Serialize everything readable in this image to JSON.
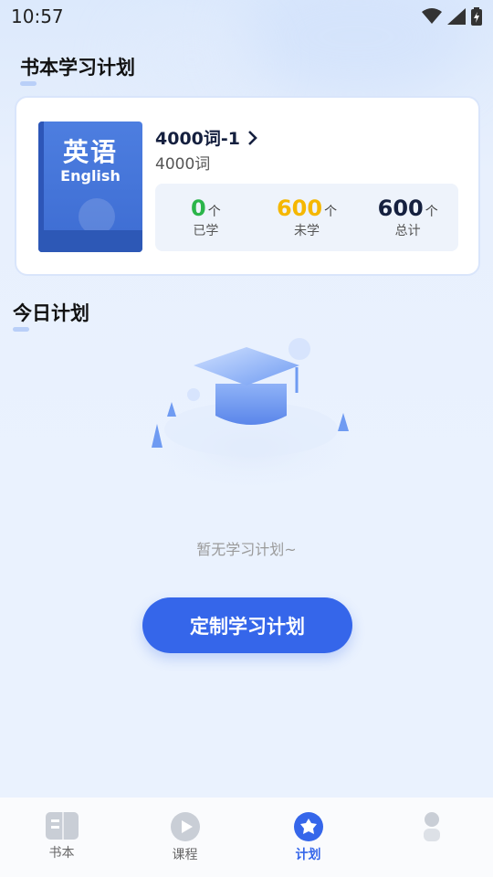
{
  "status_bar": {
    "time": "10:57"
  },
  "book_section": {
    "title": "书本学习计划"
  },
  "book": {
    "cover_zh": "英语",
    "cover_en": "English",
    "title": "4000词-1",
    "subtitle": "4000词",
    "stats": [
      {
        "value": "0",
        "unit": "个",
        "label": "已学",
        "color": "#2bb54a"
      },
      {
        "value": "600",
        "unit": "个",
        "label": "未学",
        "color": "#f5b700"
      },
      {
        "value": "600",
        "unit": "个",
        "label": "总计",
        "color": "#15203f"
      }
    ]
  },
  "today_section": {
    "title": "今日计划"
  },
  "empty_state": {
    "text": "暂无学习计划~"
  },
  "cta": {
    "label": "定制学习计划"
  },
  "tabbar": {
    "items": [
      {
        "label": "书本",
        "icon": "book-icon"
      },
      {
        "label": "课程",
        "icon": "play-icon"
      },
      {
        "label": "计划",
        "icon": "plan-icon",
        "active": true
      },
      {
        "label": "",
        "icon": "person-icon"
      }
    ]
  },
  "colors": {
    "accent": "#3566ea"
  }
}
